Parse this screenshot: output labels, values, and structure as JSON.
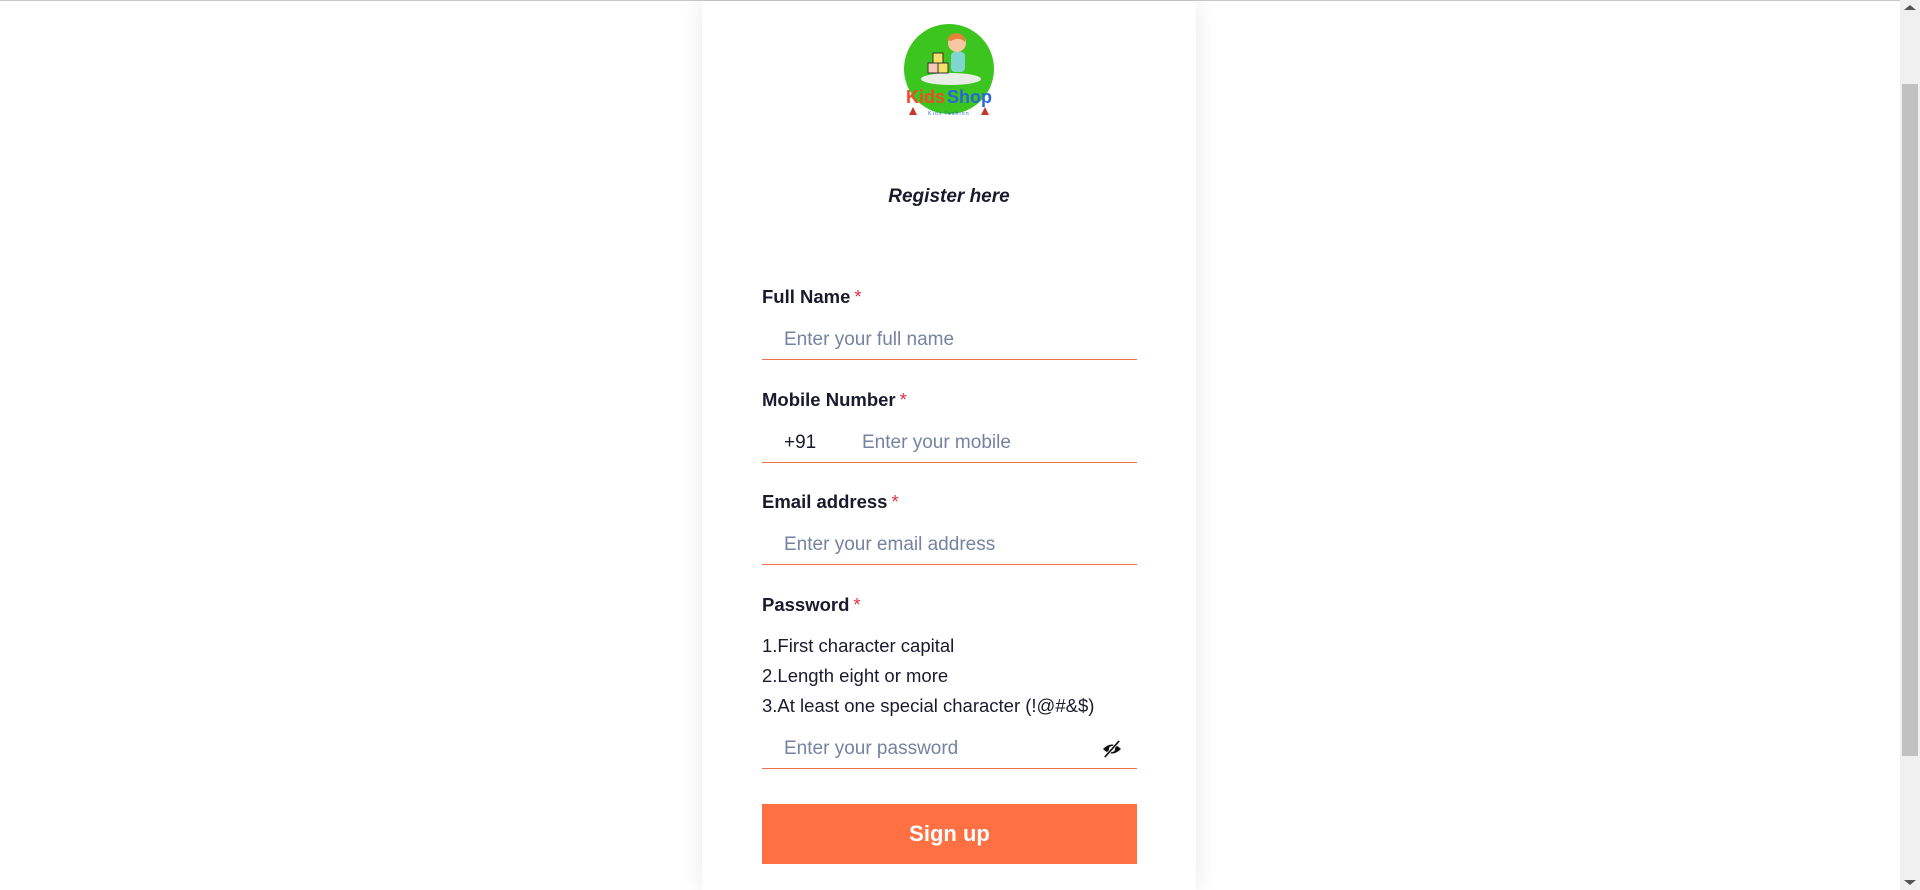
{
  "brand": {
    "name_part1": "Kids",
    "name_part2": "Shop",
    "tagline": "Kids fashion",
    "colors": {
      "circle": "#3cc41f",
      "kids": "#f04a2a",
      "shop": "#2a66d8"
    }
  },
  "form": {
    "title": "Register here",
    "required_mark": "*",
    "fields": {
      "full_name": {
        "label": "Full Name",
        "placeholder": "Enter your full name",
        "value": ""
      },
      "mobile": {
        "label": "Mobile Number",
        "prefix": "+91",
        "placeholder": "Enter your mobile",
        "value": ""
      },
      "email": {
        "label": "Email address",
        "placeholder": "Enter your email address",
        "value": ""
      },
      "password": {
        "label": "Password",
        "rules": [
          "1.First character capital",
          "2.Length eight or more",
          "3.At least one special character (!@#&$)"
        ],
        "placeholder": "Enter your password",
        "value": "",
        "toggle_icon": "eye-slash-icon"
      }
    },
    "submit_label": "Sign up"
  },
  "theme": {
    "accent": "#ff7043",
    "underline": "#f07048",
    "required": "#e0314b"
  }
}
